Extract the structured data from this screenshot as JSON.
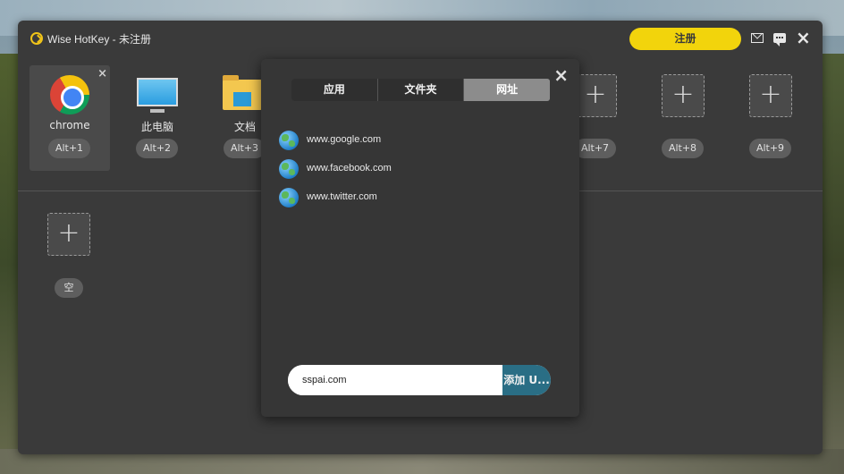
{
  "window": {
    "title": "Wise HotKey - 未注册",
    "register_label": "注册"
  },
  "slots": [
    {
      "label": "chrome",
      "hotkey": "Alt+1",
      "icon": "chrome-icon"
    },
    {
      "label": "此电脑",
      "hotkey": "Alt+2",
      "icon": "monitor-icon"
    },
    {
      "label": "文档",
      "hotkey": "Alt+3",
      "icon": "folder-icon"
    },
    {
      "label": "",
      "hotkey": "Alt+7",
      "icon": "plus-icon"
    },
    {
      "label": "",
      "hotkey": "Alt+8",
      "icon": "plus-icon"
    },
    {
      "label": "",
      "hotkey": "Alt+9",
      "icon": "plus-icon"
    }
  ],
  "empty_slot": {
    "hotkey": "空"
  },
  "popup": {
    "tabs": [
      {
        "label": "应用",
        "active": false
      },
      {
        "label": "文件夹",
        "active": false
      },
      {
        "label": "网址",
        "active": true
      }
    ],
    "urls": [
      {
        "text": "www.google.com"
      },
      {
        "text": "www.facebook.com"
      },
      {
        "text": "www.twitter.com"
      }
    ],
    "input_value": "sspai.com",
    "add_button_label": "添加 U..."
  },
  "icons": {
    "close": "×",
    "plus": "+"
  },
  "colors": {
    "accent": "#f2d40c",
    "window_bg": "#3a3a3a",
    "active_tab": "#8c8c8c",
    "add_button": "#2a6e85"
  }
}
